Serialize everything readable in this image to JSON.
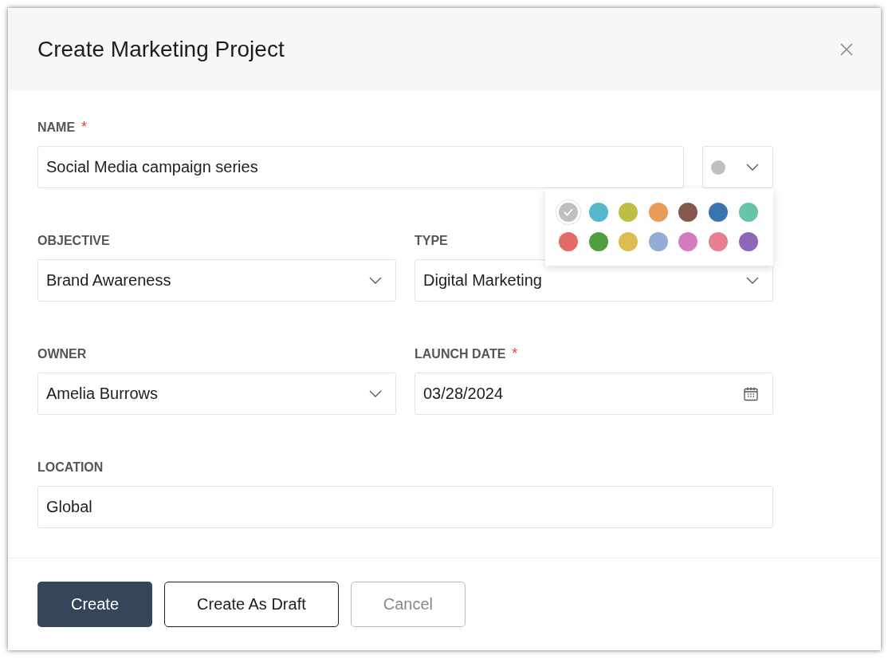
{
  "dialog": {
    "title": "Create Marketing Project"
  },
  "name_field": {
    "label": "NAME",
    "required_mark": "*",
    "value": "Social Media campaign series"
  },
  "color_picker": {
    "swatches": [
      {
        "color": "#bfbfbf",
        "selected": true
      },
      {
        "color": "#55b8cc",
        "selected": false
      },
      {
        "color": "#bfbd44",
        "selected": false
      },
      {
        "color": "#e89c58",
        "selected": false
      },
      {
        "color": "#83594d",
        "selected": false
      },
      {
        "color": "#3a74b0",
        "selected": false
      },
      {
        "color": "#68c4a8",
        "selected": false
      },
      {
        "color": "#e06b68",
        "selected": false
      },
      {
        "color": "#519e3e",
        "selected": false
      },
      {
        "color": "#dcbd52",
        "selected": false
      },
      {
        "color": "#93acd6",
        "selected": false
      },
      {
        "color": "#d47cbf",
        "selected": false
      },
      {
        "color": "#e67f8f",
        "selected": false
      },
      {
        "color": "#8e67b8",
        "selected": false
      }
    ]
  },
  "fields": [
    {
      "label": "OBJECTIVE",
      "kind": "select",
      "value": "Brand Awareness"
    },
    {
      "label": "TYPE",
      "kind": "select",
      "value": "Digital Marketing"
    },
    {
      "label": "OWNER",
      "kind": "select",
      "value": "Amelia Burrows"
    },
    {
      "label": "LAUNCH DATE",
      "kind": "date",
      "required_mark": "*",
      "value": "03/28/2024"
    },
    {
      "label": "LOCATION",
      "kind": "text",
      "value": "Global"
    }
  ],
  "buttons": [
    {
      "label": "Create",
      "kind": "primary"
    },
    {
      "label": "Create As Draft",
      "kind": "secondary"
    },
    {
      "label": "Cancel",
      "kind": "cancel"
    }
  ]
}
